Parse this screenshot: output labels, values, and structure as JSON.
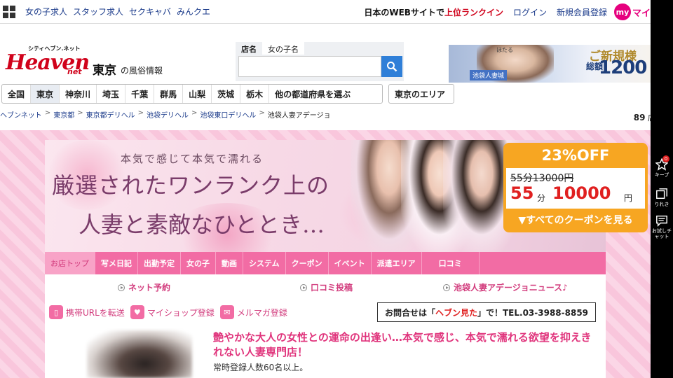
{
  "topbar": {
    "links": [
      "女の子求人",
      "スタッフ求人",
      "セクキャバ",
      "みんクエ"
    ],
    "rank_prefix": "日本のWEBサイトで",
    "rank_highlight": "上位ランクイン",
    "login": "ログイン",
    "register": "新規会員登録",
    "my_badge": "my",
    "my_text": "マイ"
  },
  "header": {
    "logo_small": "シティヘブン.ネット",
    "logo_big": "Heaven",
    "logo_net": "net",
    "area_title": "東京",
    "area_sub": "の風俗情報",
    "search_tabs": [
      "店名",
      "女の子名"
    ],
    "search_placeholder": "",
    "banner": {
      "label": "池袋人妻城",
      "name": "ほたる",
      "title": "ご新規様",
      "total": "総額",
      "amount": "1200"
    }
  },
  "areanav": {
    "prefectures": [
      "全国",
      "東京",
      "神奈川",
      "埼玉",
      "千葉",
      "群馬",
      "山梨",
      "茨城",
      "栃木",
      "他の都道府県を選ぶ"
    ],
    "active": "東京",
    "area_button": "東京のエリア"
  },
  "breadcrumb": {
    "items": [
      "ヘブンネット",
      "東京都",
      "東京都デリヘル",
      "池袋デリヘル",
      "池袋東口デリヘル",
      "池袋人妻アデージョ"
    ]
  },
  "shopcount": {
    "number": "89",
    "unit": "店舗"
  },
  "hero": {
    "tagline": "本気で感じて本気で濡れる",
    "line1": "厳選されたワンランク上の",
    "line2": "人妻と素敵なひととき…"
  },
  "coupon": {
    "percent": "23%OFF",
    "old_price": "55分13000円",
    "new_minutes": "55",
    "minute_unit": "分",
    "new_price": "10000",
    "yen": "円",
    "link": "▼すべてのクーポンを見る"
  },
  "shopnav": {
    "items": [
      "お店トップ",
      "写メ日記",
      "出勤予定",
      "女の子",
      "動画",
      "システム",
      "クーポン",
      "イベント",
      "派遣エリア",
      "口コミ"
    ]
  },
  "quicklinks": [
    "ネット予約",
    "口コミ投稿",
    "池袋人妻アデージョニュース♪"
  ],
  "actions": {
    "items": [
      "携帯URLを転送",
      "マイショップ登録",
      "メルマガ登録"
    ],
    "inquiry_prefix": "お問合せは「",
    "inquiry_highlight": "ヘブン見た",
    "inquiry_suffix": "」で！TEL.03-3988-8859"
  },
  "catch": {
    "text": "艶やかな大人の女性との運命の出逢い…本気で感じ、本気で濡れる欲望を抑えきれない人妻専門店！",
    "regcount": "常時登録人数60名以上。"
  },
  "sidebar": {
    "keep_count": "0",
    "keep_label": "キープ",
    "history_label": "りれき",
    "chat_label": "お試しチャット"
  },
  "colors": {
    "accent_pink": "#f26ca4",
    "text_pink": "#e0347c",
    "coupon_orange": "#f7a622",
    "link_blue": "#1a3a8a",
    "search_blue": "#2f7fd8",
    "logo_red": "#d0021b"
  }
}
